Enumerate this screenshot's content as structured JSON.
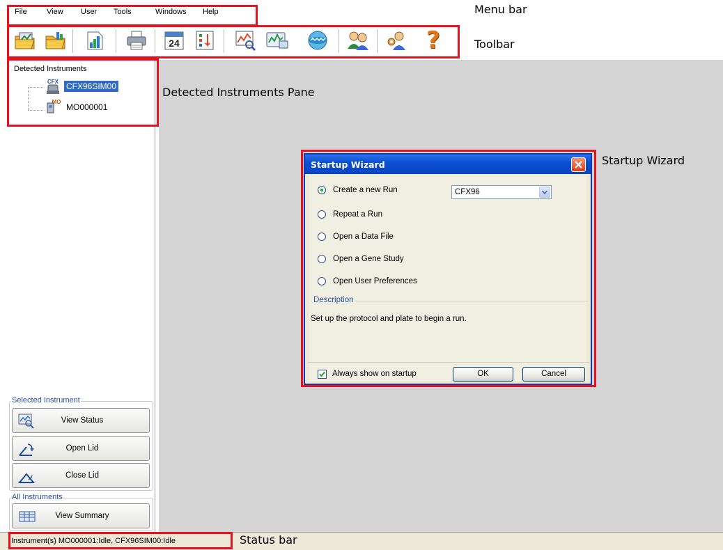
{
  "menu": {
    "items": [
      "File",
      "View",
      "User",
      "Tools",
      "Windows",
      "Help"
    ]
  },
  "toolbar": {
    "buttons": [
      {
        "icon": "open-run-icon"
      },
      {
        "icon": "open-data-file-icon"
      },
      {
        "icon": "open-gene-study-icon"
      },
      {
        "icon": "print-icon"
      },
      {
        "icon": "calendar-icon",
        "text": "24"
      },
      {
        "icon": "sort-icon"
      },
      {
        "icon": "select-wells-icon"
      },
      {
        "icon": "instrument-status-icon"
      },
      {
        "icon": "disk-icon"
      },
      {
        "icon": "users-icon"
      },
      {
        "icon": "user-preferences-icon"
      },
      {
        "icon": "help-icon",
        "text": "?"
      }
    ]
  },
  "annotations": {
    "menu_bar": "Menu bar",
    "toolbar": "Toolbar",
    "detected_pane": "Detected Instruments Pane",
    "startup_wizard": "Startup Wizard",
    "status_bar": "Status bar"
  },
  "detected_instruments": {
    "title": "Detected Instruments",
    "items": [
      {
        "name": "CFX96SIM00",
        "badge": "CFX",
        "selected": true
      },
      {
        "name": "MO000001",
        "badge": "MO",
        "selected": false
      }
    ]
  },
  "selected_instrument": {
    "title": "Selected Instrument",
    "buttons": [
      "View Status",
      "Open Lid",
      "Close Lid"
    ]
  },
  "all_instruments": {
    "title": "All Instruments",
    "buttons": [
      "View Summary"
    ]
  },
  "wizard": {
    "title": "Startup Wizard",
    "options": [
      {
        "label": "Create a new Run",
        "checked": true
      },
      {
        "label": "Repeat a Run",
        "checked": false
      },
      {
        "label": "Open a Data File",
        "checked": false
      },
      {
        "label": "Open a Gene Study",
        "checked": false
      },
      {
        "label": "Open User Preferences",
        "checked": false
      }
    ],
    "instrument_select": "CFX96",
    "description_title": "Description",
    "description": "Set up the protocol and plate to begin a run.",
    "always_show_label": "Always show on startup",
    "always_show_checked": true,
    "ok_label": "OK",
    "cancel_label": "Cancel"
  },
  "status": {
    "text": "Instrument(s)  MO000001:Idle,  CFX96SIM00:Idle"
  },
  "colors": {
    "annotation_red": "#e8121e",
    "title_bar_blue": "#0a4fd2",
    "selection_blue": "#316ac5"
  }
}
